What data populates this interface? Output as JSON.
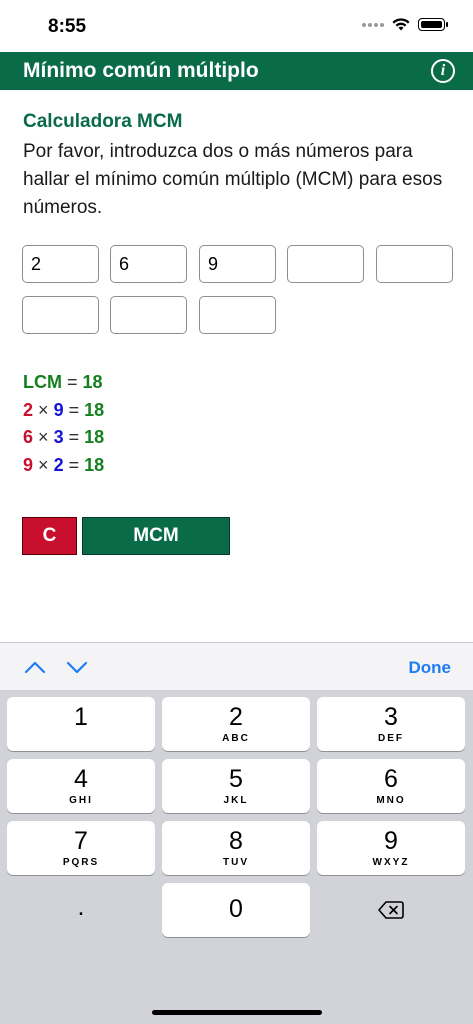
{
  "status": {
    "time": "8:55"
  },
  "header": {
    "title": "Mínimo común múltiplo",
    "info_icon": "info-icon"
  },
  "content": {
    "subtitle": "Calculadora MCM",
    "description": "Por favor, introduzca dos o más números para hallar el mínimo común múltiplo (MCM) para esos números."
  },
  "inputs": [
    "2",
    "6",
    "9",
    "",
    "",
    "",
    "",
    ""
  ],
  "results": {
    "lcm_label": "LCM",
    "eq": "=",
    "times": "×",
    "lcm_value": "18",
    "rows": [
      {
        "a": "2",
        "b": "9",
        "r": "18"
      },
      {
        "a": "6",
        "b": "3",
        "r": "18"
      },
      {
        "a": "9",
        "b": "2",
        "r": "18"
      }
    ]
  },
  "buttons": {
    "clear": "C",
    "calc": "MCM"
  },
  "accessory": {
    "done": "Done"
  },
  "keyboard": {
    "keys": [
      {
        "num": "1",
        "letters": ""
      },
      {
        "num": "2",
        "letters": "ABC"
      },
      {
        "num": "3",
        "letters": "DEF"
      },
      {
        "num": "4",
        "letters": "GHI"
      },
      {
        "num": "5",
        "letters": "JKL"
      },
      {
        "num": "6",
        "letters": "MNO"
      },
      {
        "num": "7",
        "letters": "PQRS"
      },
      {
        "num": "8",
        "letters": "TUV"
      },
      {
        "num": "9",
        "letters": "WXYZ"
      }
    ],
    "dot": ".",
    "zero": "0"
  },
  "colors": {
    "header_green": "#0a6b48",
    "result_green": "#15801d",
    "red": "#c8102e",
    "blue": "#1515d6",
    "done_blue": "#1e7cf2"
  }
}
